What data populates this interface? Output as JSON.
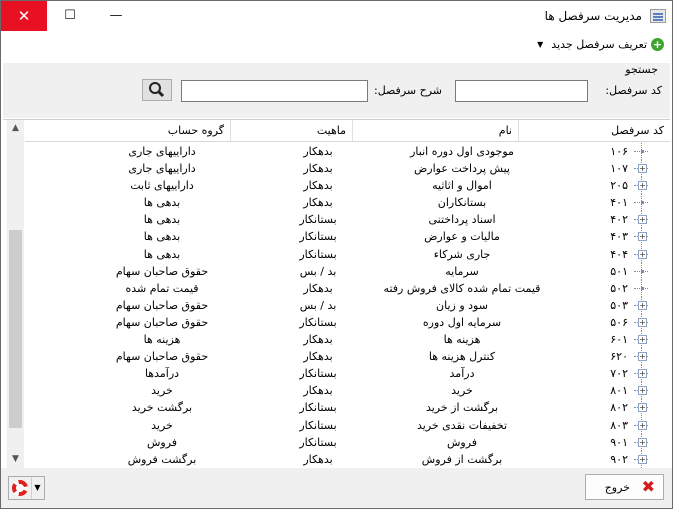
{
  "window": {
    "title": "مدیریت سرفصل ها",
    "close_symbol": "✕",
    "maximize_symbol": "☐",
    "minimize_symbol": "—"
  },
  "toolbar": {
    "new_label": "تعریف سرفصل جدید"
  },
  "search": {
    "title": "جستجو",
    "code_label": "کد سرفصل:",
    "desc_label": "شرح سرفصل:",
    "code_value": "",
    "desc_value": "",
    "button_icon": "search-icon"
  },
  "grid": {
    "headers": [
      "کد سرفصل",
      "نام",
      "ماهیت",
      "گروه حساب"
    ],
    "rows": [
      {
        "code": "۱۰۶",
        "name": "موجودی اول دوره انبار",
        "nature": "بدهکار",
        "group": "داراییهای جاری",
        "expandable": false
      },
      {
        "code": "۱۰۷",
        "name": "پیش پرداخت عوارض",
        "nature": "بدهکار",
        "group": "داراییهای جاری",
        "expandable": true
      },
      {
        "code": "۲۰۵",
        "name": "اموال و اثاثیه",
        "nature": "بدهکار",
        "group": "داراییهای ثابت",
        "expandable": true
      },
      {
        "code": "۴۰۱",
        "name": "بستانکاران",
        "nature": "بدهکار",
        "group": "بدهی ها",
        "expandable": false
      },
      {
        "code": "۴۰۲",
        "name": "اسناد پرداختنی",
        "nature": "بستانکار",
        "group": "بدهی ها",
        "expandable": true
      },
      {
        "code": "۴۰۳",
        "name": "مالیات و عوارض",
        "nature": "بستانکار",
        "group": "بدهی ها",
        "expandable": true
      },
      {
        "code": "۴۰۴",
        "name": "جاری شرکاء",
        "nature": "بستانکار",
        "group": "بدهی ها",
        "expandable": true
      },
      {
        "code": "۵۰۱",
        "name": "سرمایه",
        "nature": "بد / بس",
        "group": "حقوق صاحبان سهام",
        "expandable": false
      },
      {
        "code": "۵۰۲",
        "name": "قیمت تمام شده کالای فروش رفته",
        "nature": "بدهکار",
        "group": "قیمت تمام شده",
        "expandable": false
      },
      {
        "code": "۵۰۳",
        "name": "سود و زیان",
        "nature": "بد / بس",
        "group": "حقوق صاحبان سهام",
        "expandable": true
      },
      {
        "code": "۵۰۶",
        "name": "سرمایه اول دوره",
        "nature": "بستانکار",
        "group": "حقوق صاحبان سهام",
        "expandable": true
      },
      {
        "code": "۶۰۱",
        "name": "هزینه ها",
        "nature": "بدهکار",
        "group": "هزینه ها",
        "expandable": true
      },
      {
        "code": "۶۲۰",
        "name": "کنترل هزینه ها",
        "nature": "بدهکار",
        "group": "حقوق صاحبان سهام",
        "expandable": true
      },
      {
        "code": "۷۰۲",
        "name": "درآمد",
        "nature": "بستانکار",
        "group": "درآمدها",
        "expandable": true
      },
      {
        "code": "۸۰۱",
        "name": "خرید",
        "nature": "بدهکار",
        "group": "خرید",
        "expandable": true
      },
      {
        "code": "۸۰۲",
        "name": "برگشت از خرید",
        "nature": "بستانکار",
        "group": "برگشت خرید",
        "expandable": true
      },
      {
        "code": "۸۰۳",
        "name": "تخفیفات نقدی خرید",
        "nature": "بستانکار",
        "group": "خرید",
        "expandable": true
      },
      {
        "code": "۹۰۱",
        "name": "فروش",
        "nature": "بستانکار",
        "group": "فروش",
        "expandable": true
      },
      {
        "code": "۹۰۲",
        "name": "برگشت از فروش",
        "nature": "بدهکار",
        "group": "برگشت فروش",
        "expandable": true
      }
    ]
  },
  "footer": {
    "exit_label": "خروج"
  }
}
